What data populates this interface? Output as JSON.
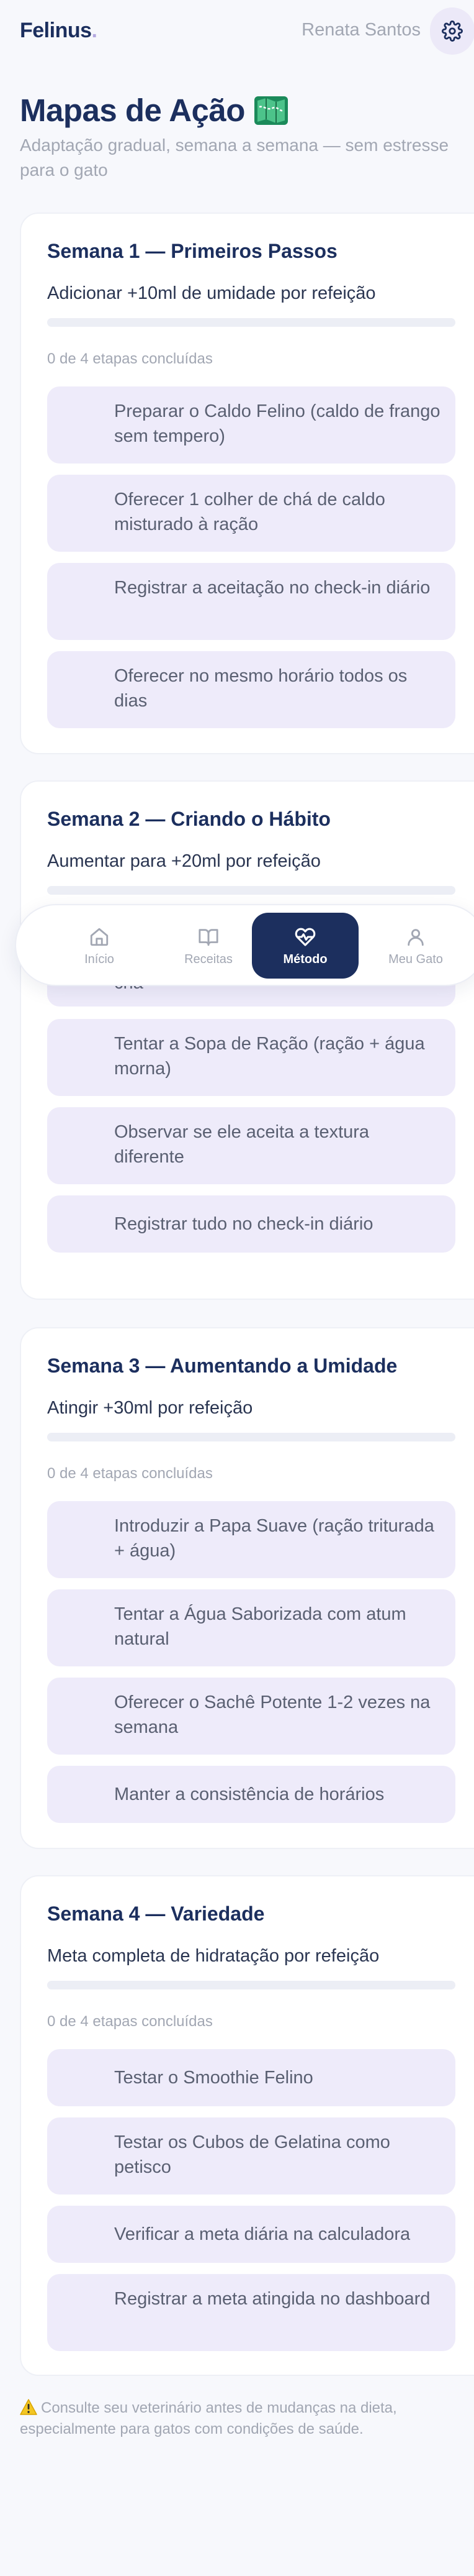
{
  "header": {
    "logo": "Felinus",
    "logo_dot": ".",
    "user_name": "Renata Santos"
  },
  "page": {
    "title": "Mapas de Ação",
    "subtitle": "Adaptação gradual, semana a semana — sem estresse para o gato"
  },
  "weeks": [
    {
      "title": "Semana 1 — Primeiros Passos",
      "goal": "Adicionar +10ml de umidade por refeição",
      "progress_text": "0 de 4 etapas concluídas",
      "progress": 0,
      "tasks": [
        {
          "label": "Preparar o Caldo Felino (caldo de frango sem tempero)"
        },
        {
          "label": "Oferecer 1 colher de chá de caldo misturado à ração"
        },
        {
          "label": "Registrar a aceitação no check-in diário"
        },
        {
          "label": "Oferecer no mesmo horário todos os dias"
        }
      ]
    },
    {
      "title": "Semana 2 — Criando o Hábito",
      "goal": "Aumentar para +20ml por refeição",
      "progress_text": "",
      "progress": 0,
      "tasks": [
        {
          "label": "chá"
        },
        {
          "label": "Tentar a Sopa de Ração (ração + água morna)"
        },
        {
          "label": "Observar se ele aceita a textura diferente"
        },
        {
          "label": "Registrar tudo no check-in diário"
        }
      ]
    },
    {
      "title": "Semana 3 — Aumentando a Umidade",
      "goal": "Atingir +30ml por refeição",
      "progress_text": "0 de 4 etapas concluídas",
      "progress": 0,
      "tasks": [
        {
          "label": "Introduzir a Papa Suave (ração triturada + água)"
        },
        {
          "label": "Tentar a Água Saborizada com atum natural"
        },
        {
          "label": "Oferecer o Sachê Potente 1-2 vezes na semana"
        },
        {
          "label": "Manter a consistência de horários"
        }
      ]
    },
    {
      "title": "Semana 4 — Variedade",
      "goal": "Meta completa de hidratação por refeição",
      "progress_text": "0 de 4 etapas concluídas",
      "progress": 0,
      "tasks": [
        {
          "label": "Testar o Smoothie Felino"
        },
        {
          "label": "Testar os Cubos de Gelatina como petisco"
        },
        {
          "label": "Verificar a meta diária na calculadora"
        },
        {
          "label": "Registrar a meta atingida no dashboard"
        }
      ]
    }
  ],
  "nav": {
    "items": [
      {
        "label": "Início",
        "icon": "home-icon"
      },
      {
        "label": "Receitas",
        "icon": "book-icon"
      },
      {
        "label": "Método",
        "icon": "heart-pulse-icon"
      },
      {
        "label": "Meu Gato",
        "icon": "user-icon"
      }
    ],
    "active_index": 2
  },
  "footer": {
    "note": "Consulte seu veterinário antes de mudanças na dieta, especialmente para gatos com condições de saúde."
  },
  "colors": {
    "brand": "#1c2f5e",
    "task_bg": "#eeebfa",
    "muted": "#a2a7b3",
    "warning": "#f3c623"
  }
}
